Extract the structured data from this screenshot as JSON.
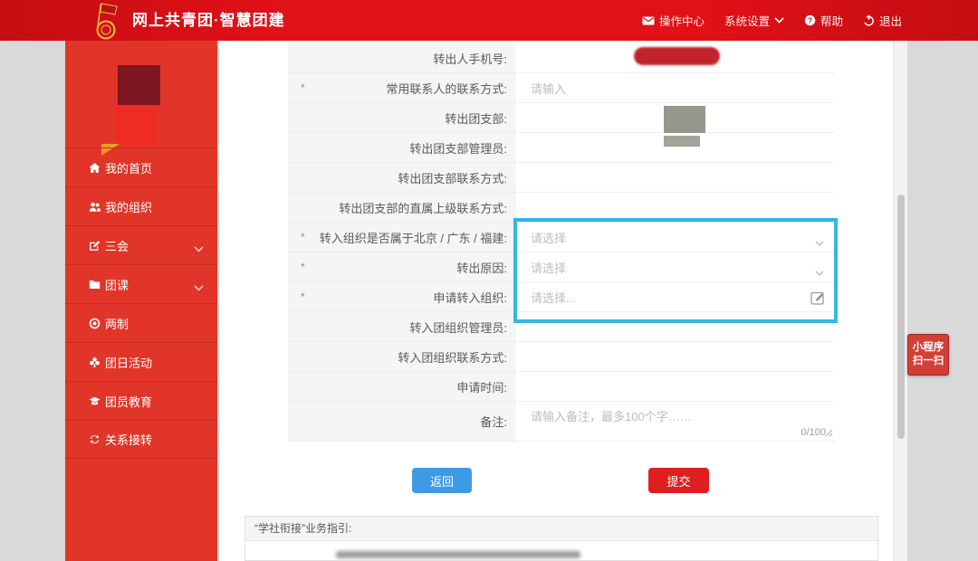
{
  "header": {
    "title": "网上共青团·智慧团建",
    "nav": [
      {
        "label": "操作中心",
        "icon": "mail-icon"
      },
      {
        "label": "系统设置",
        "icon": "chevron-down-icon"
      },
      {
        "label": "帮助",
        "icon": "question-icon"
      },
      {
        "label": "退出",
        "icon": "power-icon"
      }
    ]
  },
  "sidebar": {
    "items": [
      {
        "label": "我的首页",
        "icon": "home-icon"
      },
      {
        "label": "我的组织",
        "icon": "users-icon"
      },
      {
        "label": "三会",
        "icon": "edit-icon",
        "expandable": true
      },
      {
        "label": "团课",
        "icon": "folder-icon",
        "expandable": true
      },
      {
        "label": "两制",
        "icon": "target-icon"
      },
      {
        "label": "团日活动",
        "icon": "clover-icon"
      },
      {
        "label": "团员教育",
        "icon": "graduation-icon"
      },
      {
        "label": "关系接转",
        "icon": "transfer-icon"
      }
    ]
  },
  "form": {
    "rows": [
      {
        "label": "转出人手机号:"
      },
      {
        "star": "*",
        "label": "常用联系人的联系方式:",
        "placeholder": "请输入"
      },
      {
        "label": "转出团支部:"
      },
      {
        "label": "转出团支部管理员:"
      },
      {
        "label": "转出团支部联系方式:"
      },
      {
        "label": "转出团支部的直属上级联系方式:"
      },
      {
        "star": "*",
        "label": "转入组织是否属于北京 / 广东 / 福建:",
        "placeholder": "请选择"
      },
      {
        "star": "*",
        "label": "转出原因:",
        "placeholder": "请选择"
      },
      {
        "star": "*",
        "label": "申请转入组织:",
        "placeholder": "请选择..."
      },
      {
        "label": "转入团组织管理员:"
      },
      {
        "label": "转入团组织联系方式:"
      },
      {
        "label": "申请时间:"
      },
      {
        "label": "备注:",
        "placeholder": "请输入备注，最多100个字……",
        "counter": "0/100"
      }
    ]
  },
  "buttons": {
    "back": "返回",
    "submit": "提交"
  },
  "guide": {
    "title": "“学社衔接”业务指引:"
  },
  "badge": {
    "line1": "小程序",
    "line2": "扫一扫"
  },
  "colors": {
    "brand_red": "#e01117",
    "sidebar_red": "#e23529",
    "highlight_cyan": "#35b6e4",
    "submit_red": "#df1f1f",
    "back_blue": "#3f9ae5",
    "badge_red": "#d23f36"
  }
}
